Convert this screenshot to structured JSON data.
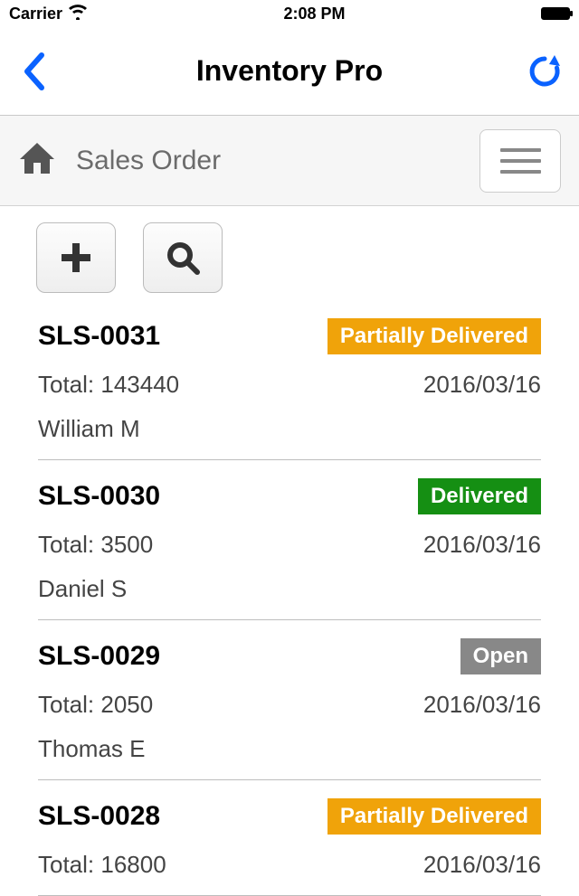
{
  "status": {
    "carrier": "Carrier",
    "time": "2:08 PM"
  },
  "nav": {
    "title": "Inventory Pro"
  },
  "subheader": {
    "title": "Sales Order"
  },
  "status_colors": {
    "partially_delivered": "#f0a30a",
    "delivered": "#158f13",
    "open": "#888888"
  },
  "orders": [
    {
      "id": "SLS-0031",
      "status_label": "Partially Delivered",
      "status_key": "partially_delivered",
      "total_label": "Total: 143440",
      "date": "2016/03/16",
      "customer": "William M"
    },
    {
      "id": "SLS-0030",
      "status_label": "Delivered",
      "status_key": "delivered",
      "total_label": "Total: 3500",
      "date": "2016/03/16",
      "customer": "Daniel S"
    },
    {
      "id": "SLS-0029",
      "status_label": "Open",
      "status_key": "open",
      "total_label": "Total: 2050",
      "date": "2016/03/16",
      "customer": "Thomas E"
    },
    {
      "id": "SLS-0028",
      "status_label": "Partially Delivered",
      "status_key": "partially_delivered",
      "total_label": "Total: 16800",
      "date": "2016/03/16",
      "customer": ""
    }
  ]
}
